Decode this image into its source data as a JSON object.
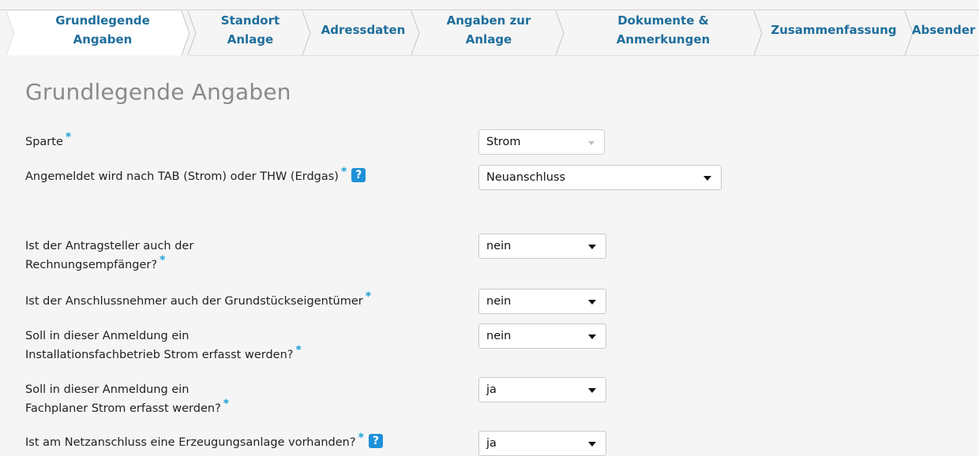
{
  "wizard": {
    "steps": [
      {
        "line1": "Grundlegende",
        "line2": "Angaben"
      },
      {
        "line1": "Standort",
        "line2": "Anlage"
      },
      {
        "line1": "Adressdaten",
        "line2": ""
      },
      {
        "line1": "Angaben zur",
        "line2": "Anlage"
      },
      {
        "line1": "Dokumente &",
        "line2": "Anmerkungen"
      },
      {
        "line1": "Zusammenfassung",
        "line2": ""
      },
      {
        "line1": "Absender",
        "line2": ""
      }
    ]
  },
  "page": {
    "title": "Grundlegende Angaben"
  },
  "form": {
    "required_mark": "*",
    "help_mark": "?",
    "fields": [
      {
        "label": "Sparte",
        "value": "Strom"
      },
      {
        "label": "Angemeldet wird nach TAB (Strom) oder THW (Erdgas)",
        "value": "Neuanschluss"
      },
      {
        "label_line1": "Ist der Antragsteller auch der",
        "label_line2": "Rechnungsempfänger?",
        "value": "nein"
      },
      {
        "label": "Ist der Anschlussnehmer auch der Grundstückseigentümer",
        "value": "nein"
      },
      {
        "label_line1": "Soll in dieser Anmeldung ein",
        "label_line2": "Installationsfachbetrieb Strom erfasst werden?",
        "value": "nein"
      },
      {
        "label_line1": "Soll in dieser Anmeldung ein",
        "label_line2": "Fachplaner Strom erfasst werden?",
        "value": "ja"
      },
      {
        "label": "Ist am Netzanschluss eine Erzeugungsanlage vorhanden?",
        "value": "ja"
      }
    ]
  },
  "colors": {
    "accent": "#1f6e9c",
    "required": "#1aa0d8",
    "help": "#1e90d8",
    "background": "#f5f5f5"
  }
}
